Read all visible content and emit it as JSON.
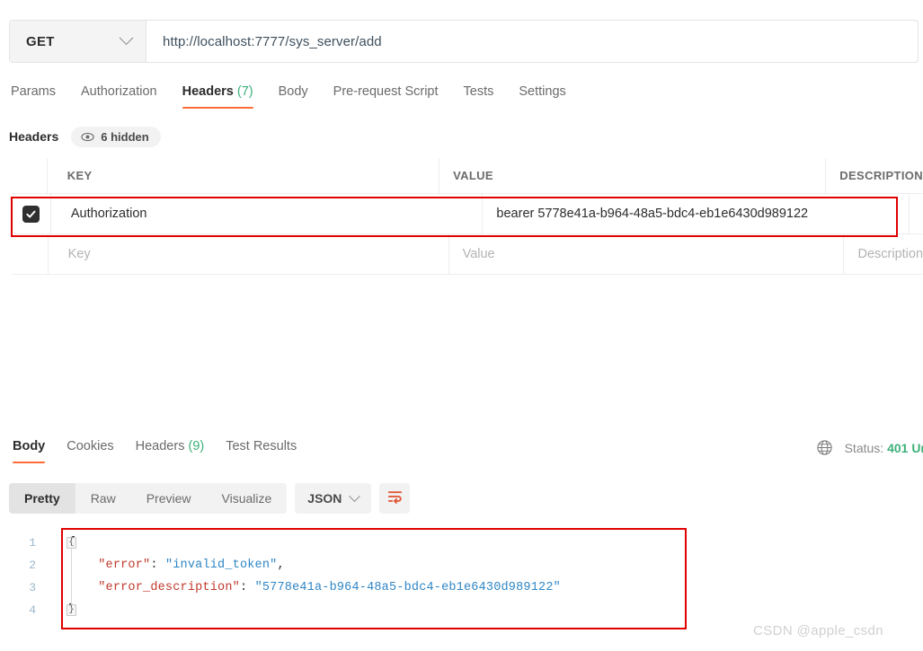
{
  "request": {
    "method": "GET",
    "url": "http://localhost:7777/sys_server/add",
    "method_dropdown_icon": "chevron-down-icon",
    "tabs": [
      {
        "label": "Params",
        "active": false
      },
      {
        "label": "Authorization",
        "active": false
      },
      {
        "label": "Headers",
        "count": "(7)",
        "active": true
      },
      {
        "label": "Body",
        "active": false
      },
      {
        "label": "Pre-request Script",
        "active": false
      },
      {
        "label": "Tests",
        "active": false
      },
      {
        "label": "Settings",
        "active": false
      }
    ],
    "headers_section": {
      "title": "Headers",
      "hidden_badge": "6 hidden",
      "hidden_badge_icon": "eye-icon",
      "columns": [
        "KEY",
        "VALUE",
        "DESCRIPTION"
      ],
      "rows": [
        {
          "checked": true,
          "key": "Authorization",
          "value": "bearer 5778e41a-b964-48a5-bdc4-eb1e6430d989122",
          "description": "",
          "highlighted": true
        },
        {
          "checked": false,
          "key": "Key",
          "value": "Value",
          "description": "Description",
          "placeholder": true
        }
      ]
    }
  },
  "response": {
    "tabs": [
      {
        "label": "Body",
        "active": true
      },
      {
        "label": "Cookies",
        "active": false
      },
      {
        "label": "Headers",
        "count": "(9)",
        "active": false
      },
      {
        "label": "Test Results",
        "active": false
      }
    ],
    "status_icon": "globe-icon",
    "status_label": "Status:",
    "status_code": "401 Un",
    "view_modes": [
      {
        "label": "Pretty",
        "active": true
      },
      {
        "label": "Raw",
        "active": false
      },
      {
        "label": "Preview",
        "active": false
      },
      {
        "label": "Visualize",
        "active": false
      }
    ],
    "format": "JSON",
    "format_dropdown_icon": "chevron-down-icon",
    "wrap_icon": "word-wrap-icon",
    "body_lines": [
      {
        "num": "1",
        "indent": "",
        "text": "{",
        "type": "brace"
      },
      {
        "num": "2",
        "indent": "    ",
        "key": "\"error\"",
        "sep": ": ",
        "value": "\"invalid_token\"",
        "tail": ","
      },
      {
        "num": "3",
        "indent": "    ",
        "key": "\"error_description\"",
        "sep": ": ",
        "value": "\"5778e41a-b964-48a5-bdc4-eb1e6430d989122\"",
        "tail": ""
      },
      {
        "num": "4",
        "indent": "",
        "text": "}",
        "type": "brace"
      }
    ]
  },
  "annotations": {
    "highlight_color": "#e00000",
    "accent_color": "#ff6c37",
    "count_color": "#3cb179"
  },
  "watermark": "CSDN @apple_csdn"
}
